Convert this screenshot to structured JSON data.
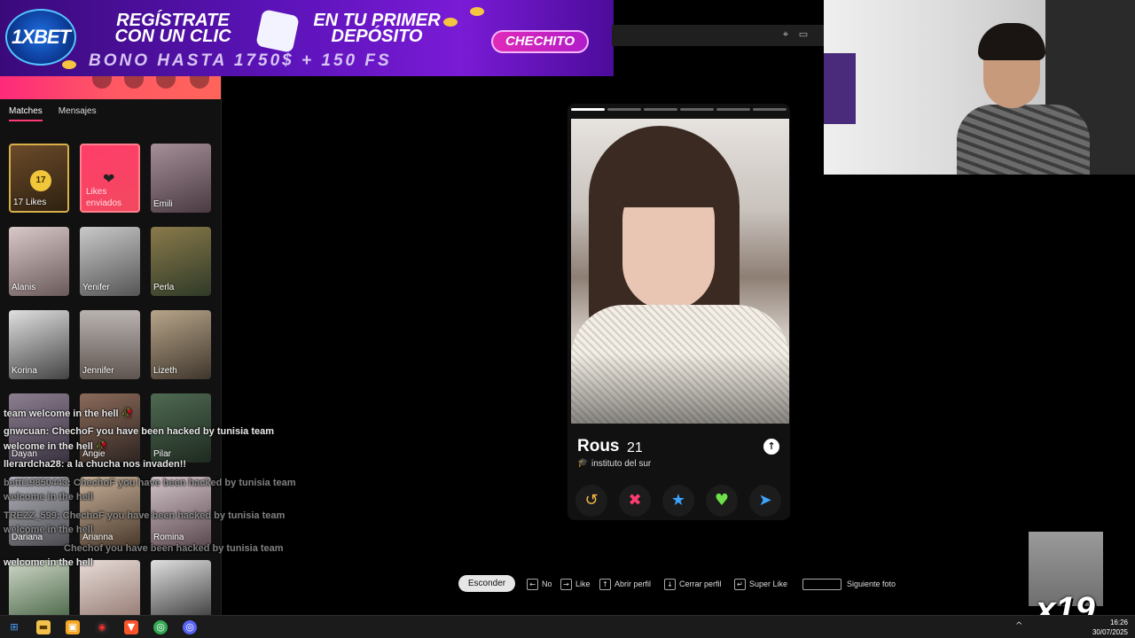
{
  "banner": {
    "brand": "1XBET",
    "headline_1": "REGÍSTRATE CON UN CLIC",
    "headline_2": "EN TU PRIMER DEPÓSITO",
    "bonus": "BONO HASTA 1750$ + 150 FS",
    "promo_code": "CHECHITO",
    "colors": {
      "background": "#5b13b8",
      "promo": "#e02ab8"
    }
  },
  "sidebar": {
    "tabs": [
      {
        "label": "Matches",
        "active": true
      },
      {
        "label": "Mensajes",
        "active": false
      }
    ],
    "likes_tile": {
      "count": "17",
      "label": "17 Likes"
    },
    "sent_tile": {
      "label": "Likes enviados"
    },
    "matches": [
      {
        "name": "Emili"
      },
      {
        "name": "Alanis"
      },
      {
        "name": "Yenifer"
      },
      {
        "name": "Perla"
      },
      {
        "name": "Korina"
      },
      {
        "name": "Jennifer"
      },
      {
        "name": "Lizeth"
      },
      {
        "name": "Dayan"
      },
      {
        "name": "Angie"
      },
      {
        "name": "Pilar"
      },
      {
        "name": "Dariana"
      },
      {
        "name": "Arianna"
      },
      {
        "name": "Romina"
      }
    ],
    "accent_color": "#fd3a73"
  },
  "chat": {
    "lines": [
      {
        "text": "team welcome in the hell 🥀",
        "dim": false
      },
      {
        "text": "gnwcuan: ChechoF you have been hacked by tunisia team",
        "dim": false
      },
      {
        "text": "welcome in the hell 🥀",
        "dim": false
      },
      {
        "text": "llerardcha28: a la chucha nos invaden!!",
        "dim": false
      },
      {
        "text": "betti19850443: ChechoF you have been hacked by tunisia team",
        "dim": true
      },
      {
        "text": "welcome in the hell",
        "dim": true
      },
      {
        "text": "TREZZ_599: ChechoF you have been hacked by tunisia team",
        "dim": true
      },
      {
        "text": "welcome in the hell",
        "dim": true
      },
      {
        "text": "Chechof you have been hacked by tunisia team",
        "dim": true
      },
      {
        "text": "welcome in the hell",
        "dim": false
      }
    ]
  },
  "profile": {
    "name": "Rous",
    "age": "21",
    "school": "instituto del sur",
    "photo_count": 6,
    "current_photo": 1,
    "actions": [
      {
        "name": "rewind",
        "glyph": "↺",
        "color": "#f5b748"
      },
      {
        "name": "nope",
        "glyph": "✖",
        "color": "#fe3c72"
      },
      {
        "name": "super-like",
        "glyph": "★",
        "color": "#3ca4ff"
      },
      {
        "name": "like",
        "glyph": "♥",
        "color": "#6ee14a"
      },
      {
        "name": "boost",
        "glyph": "➤",
        "color": "#3ca4ff"
      }
    ]
  },
  "hints": {
    "hide_label": "Esconder",
    "items": [
      {
        "key": "←",
        "label": "No"
      },
      {
        "key": "→",
        "label": "Like"
      },
      {
        "key": "↑",
        "label": "Abrir perfil"
      },
      {
        "key": "↓",
        "label": "Cerrar perfil"
      },
      {
        "key": "↵",
        "label": "Super Like"
      },
      {
        "key": "space",
        "label": "Siguiente foto"
      }
    ]
  },
  "overlay": {
    "counter": "x19"
  },
  "taskbar": {
    "time": "16:26",
    "date": "30/07/2025"
  }
}
